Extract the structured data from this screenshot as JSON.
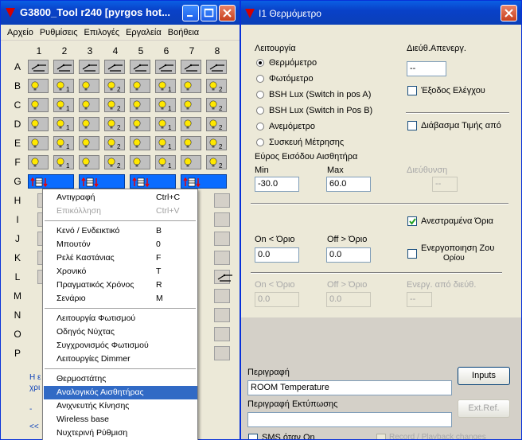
{
  "left_window": {
    "title": "G3800_Tool r240 [pyrgos hot...",
    "menu": [
      "Αρχείο",
      "Ρυθμίσεις",
      "Επιλογές",
      "Εργαλεία",
      "Βοήθεια"
    ],
    "columns": [
      "1",
      "2",
      "3",
      "4",
      "5",
      "6",
      "7",
      "8"
    ],
    "rows": [
      "A",
      "B",
      "C",
      "D",
      "E",
      "F",
      "G",
      "H",
      "I",
      "J",
      "K",
      "L",
      "M",
      "N",
      "O",
      "P"
    ],
    "bottom_fragments": [
      "Η ε",
      "χρι",
      "-",
      "<<"
    ]
  },
  "context_menu": {
    "items": [
      {
        "label": "Αντιγραφή",
        "shortcut": "Ctrl+C",
        "disabled": false
      },
      {
        "label": "Επικόλληση",
        "shortcut": "Ctrl+V",
        "disabled": true
      },
      {
        "label": "Κενό / Ενδεικτικό",
        "shortcut": "B",
        "disabled": false
      },
      {
        "label": "Μπουτόν",
        "shortcut": "0",
        "disabled": false
      },
      {
        "label": "Ρελέ Καστάνιας",
        "shortcut": "F",
        "disabled": false
      },
      {
        "label": "Χρονικό",
        "shortcut": "T",
        "disabled": false
      },
      {
        "label": "Πραγματικός Χρόνος",
        "shortcut": "R",
        "disabled": false
      },
      {
        "label": "Σενάριο",
        "shortcut": "M",
        "disabled": false
      },
      {
        "label": "Λειτουργία Φωτισμού",
        "shortcut": "",
        "disabled": false
      },
      {
        "label": "Οδηγός Νύχτας",
        "shortcut": "",
        "disabled": false
      },
      {
        "label": "Συγχρονισμός Φωτισμού",
        "shortcut": "",
        "disabled": false
      },
      {
        "label": "Λειτουργίες Dimmer",
        "shortcut": "",
        "disabled": false
      },
      {
        "label": "Θερμοστάτης",
        "shortcut": "",
        "disabled": false
      },
      {
        "label": "Αναλογικός Αισθητήρας",
        "shortcut": "",
        "disabled": false,
        "selected": true
      },
      {
        "label": "Ανιχνευτής Κίνησης",
        "shortcut": "",
        "disabled": false
      },
      {
        "label": "Wireless base",
        "shortcut": "",
        "disabled": false
      },
      {
        "label": "Νυχτερινή Ρύθμιση",
        "shortcut": "",
        "disabled": false
      }
    ]
  },
  "right_window": {
    "title": "I1   Θερμόμετρο",
    "mode_label": "Λειτουργία",
    "modes": [
      {
        "label": "Θερμόμετρο",
        "checked": true
      },
      {
        "label": "Φωτόμετρο",
        "checked": false
      },
      {
        "label": "BSH Lux  (Switch in pos A)",
        "checked": false
      },
      {
        "label": "BSH Lux (Switch in Pos B)",
        "checked": false
      },
      {
        "label": "Ανεμόμετρο",
        "checked": false
      },
      {
        "label": "Συσκευή Μέτρησης",
        "checked": false
      }
    ],
    "deactivation_address_label": "Διεύθ.Απενεργ.",
    "deactivation_address_value": "--",
    "control_output_label": "Έξοδος Ελέγχου",
    "read_value_label": "Διάβασμα Τιμής από",
    "sensor_range_label": "Εύρος Εισόδου Αισθητήρα",
    "min_label": "Min",
    "min_value": "-30.0",
    "max_label": "Max",
    "max_value": "60.0",
    "address_label": "Διεύθυνση",
    "address_value": "--",
    "inverted_limits_label": "Ανεστραμένα Όρια",
    "on_limit_label": "On < Όριο",
    "on_limit_value": "0.0",
    "off_limit_label": "Off > Όριο",
    "off_limit_value": "0.0",
    "zone_activation_label_1": "Ενεργοποιηση Ζου",
    "zone_activation_label_2": "Ορίου",
    "on_limit2_label": "On < Όριο",
    "on_limit2_value": "0.0",
    "off_limit2_label": "Off > Όριο",
    "off_limit2_value": "0.0",
    "activate_from_label": "Ενεργ. από διεύθ.",
    "activate_from_value": "--",
    "description_label": "Περιγραφή",
    "description_value": "ROOM Temperature",
    "inputs_button": "Inputs",
    "print_description_label": "Περιγραφή Εκτύπωσης",
    "print_description_value": "",
    "ext_ref_button": "Ext.Ref.",
    "sms_label": "SMS όταν On",
    "record_label": "Record / Playback changes"
  },
  "colors": {
    "titlebar": "#0a3fb8",
    "selection": "#316ac5",
    "blue_cell": "#0a6cff",
    "window_bg": "#ece9d8"
  }
}
